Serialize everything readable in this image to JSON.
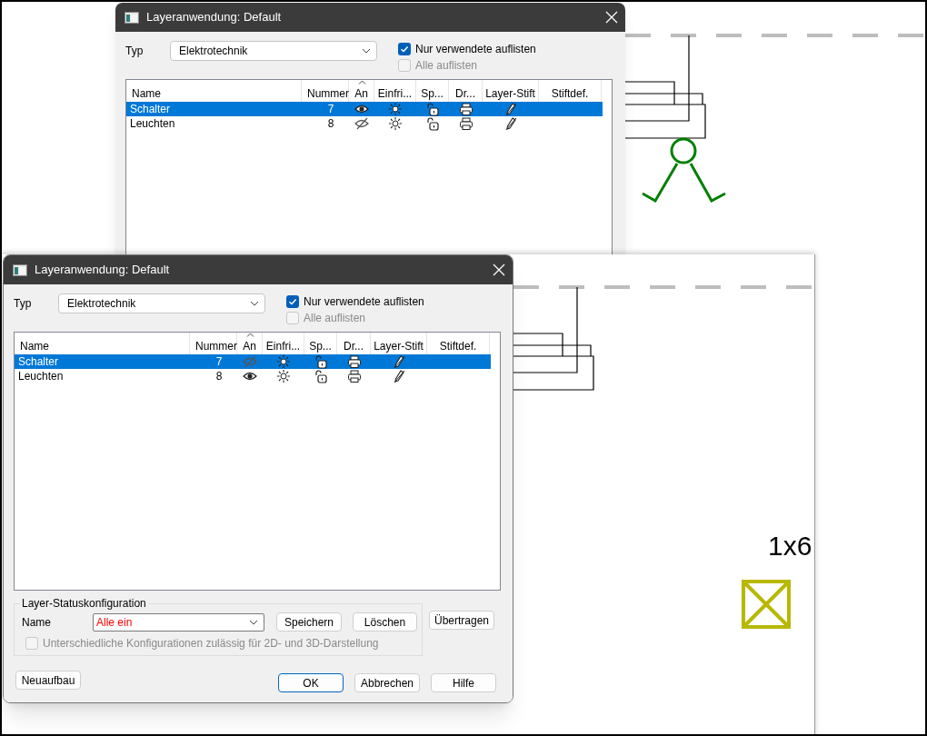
{
  "dialogs": [
    {
      "title": "Layeranwendung: Default",
      "type_label": "Typ",
      "type_value": "Elektrotechnik",
      "options": [
        {
          "label": "Nur verwendete auflisten",
          "checked": true,
          "disabled": false
        },
        {
          "label": "Alle auflisten",
          "checked": false,
          "disabled": true
        }
      ],
      "columns": [
        {
          "label": "Name",
          "sorted": false
        },
        {
          "label": "Nummer",
          "sorted": false
        },
        {
          "label": "An",
          "sorted": true
        },
        {
          "label": "Einfri...",
          "sorted": false
        },
        {
          "label": "Sp...",
          "sorted": false
        },
        {
          "label": "Dr...",
          "sorted": false
        },
        {
          "label": "Layer-Stift",
          "sorted": false
        },
        {
          "label": "Stiftdef.",
          "sorted": false
        }
      ],
      "rows": [
        {
          "name": "Schalter",
          "number": "7",
          "on": true,
          "selected": true
        },
        {
          "name": "Leuchten",
          "number": "8",
          "on": false,
          "selected": false
        }
      ]
    },
    {
      "title": "Layeranwendung: Default",
      "type_label": "Typ",
      "type_value": "Elektrotechnik",
      "options": [
        {
          "label": "Nur verwendete auflisten",
          "checked": true,
          "disabled": false
        },
        {
          "label": "Alle auflisten",
          "checked": false,
          "disabled": true
        }
      ],
      "columns": [
        {
          "label": "Name",
          "sorted": false
        },
        {
          "label": "Nummer",
          "sorted": false
        },
        {
          "label": "An",
          "sorted": true
        },
        {
          "label": "Einfri...",
          "sorted": false
        },
        {
          "label": "Sp...",
          "sorted": false
        },
        {
          "label": "Dr...",
          "sorted": false
        },
        {
          "label": "Layer-Stift",
          "sorted": false
        },
        {
          "label": "Stiftdef.",
          "sorted": false
        }
      ],
      "rows": [
        {
          "name": "Schalter",
          "number": "7",
          "on": false,
          "selected": true
        },
        {
          "name": "Leuchten",
          "number": "8",
          "on": true,
          "selected": false
        }
      ],
      "status_config": {
        "title": "Layer-Statuskonfiguration",
        "name_label": "Name",
        "name_value": "Alle ein",
        "buttons": [
          "Speichern",
          "Löschen"
        ],
        "side_button": "Übertragen",
        "option": {
          "label": "Unterschiedliche Konfigurationen zulässig für 2D- und 3D-Darstellung",
          "checked": false,
          "disabled": true
        }
      },
      "footer_buttons": [
        {
          "label": "Neuaufbau",
          "kind": "left",
          "default": false
        },
        {
          "label": "OK",
          "kind": "right",
          "default": true
        },
        {
          "label": "Abbrechen",
          "kind": "right",
          "default": false
        },
        {
          "label": "Hilfe",
          "kind": "right",
          "default": false
        }
      ]
    }
  ],
  "canvas": {
    "label": "1x6"
  }
}
